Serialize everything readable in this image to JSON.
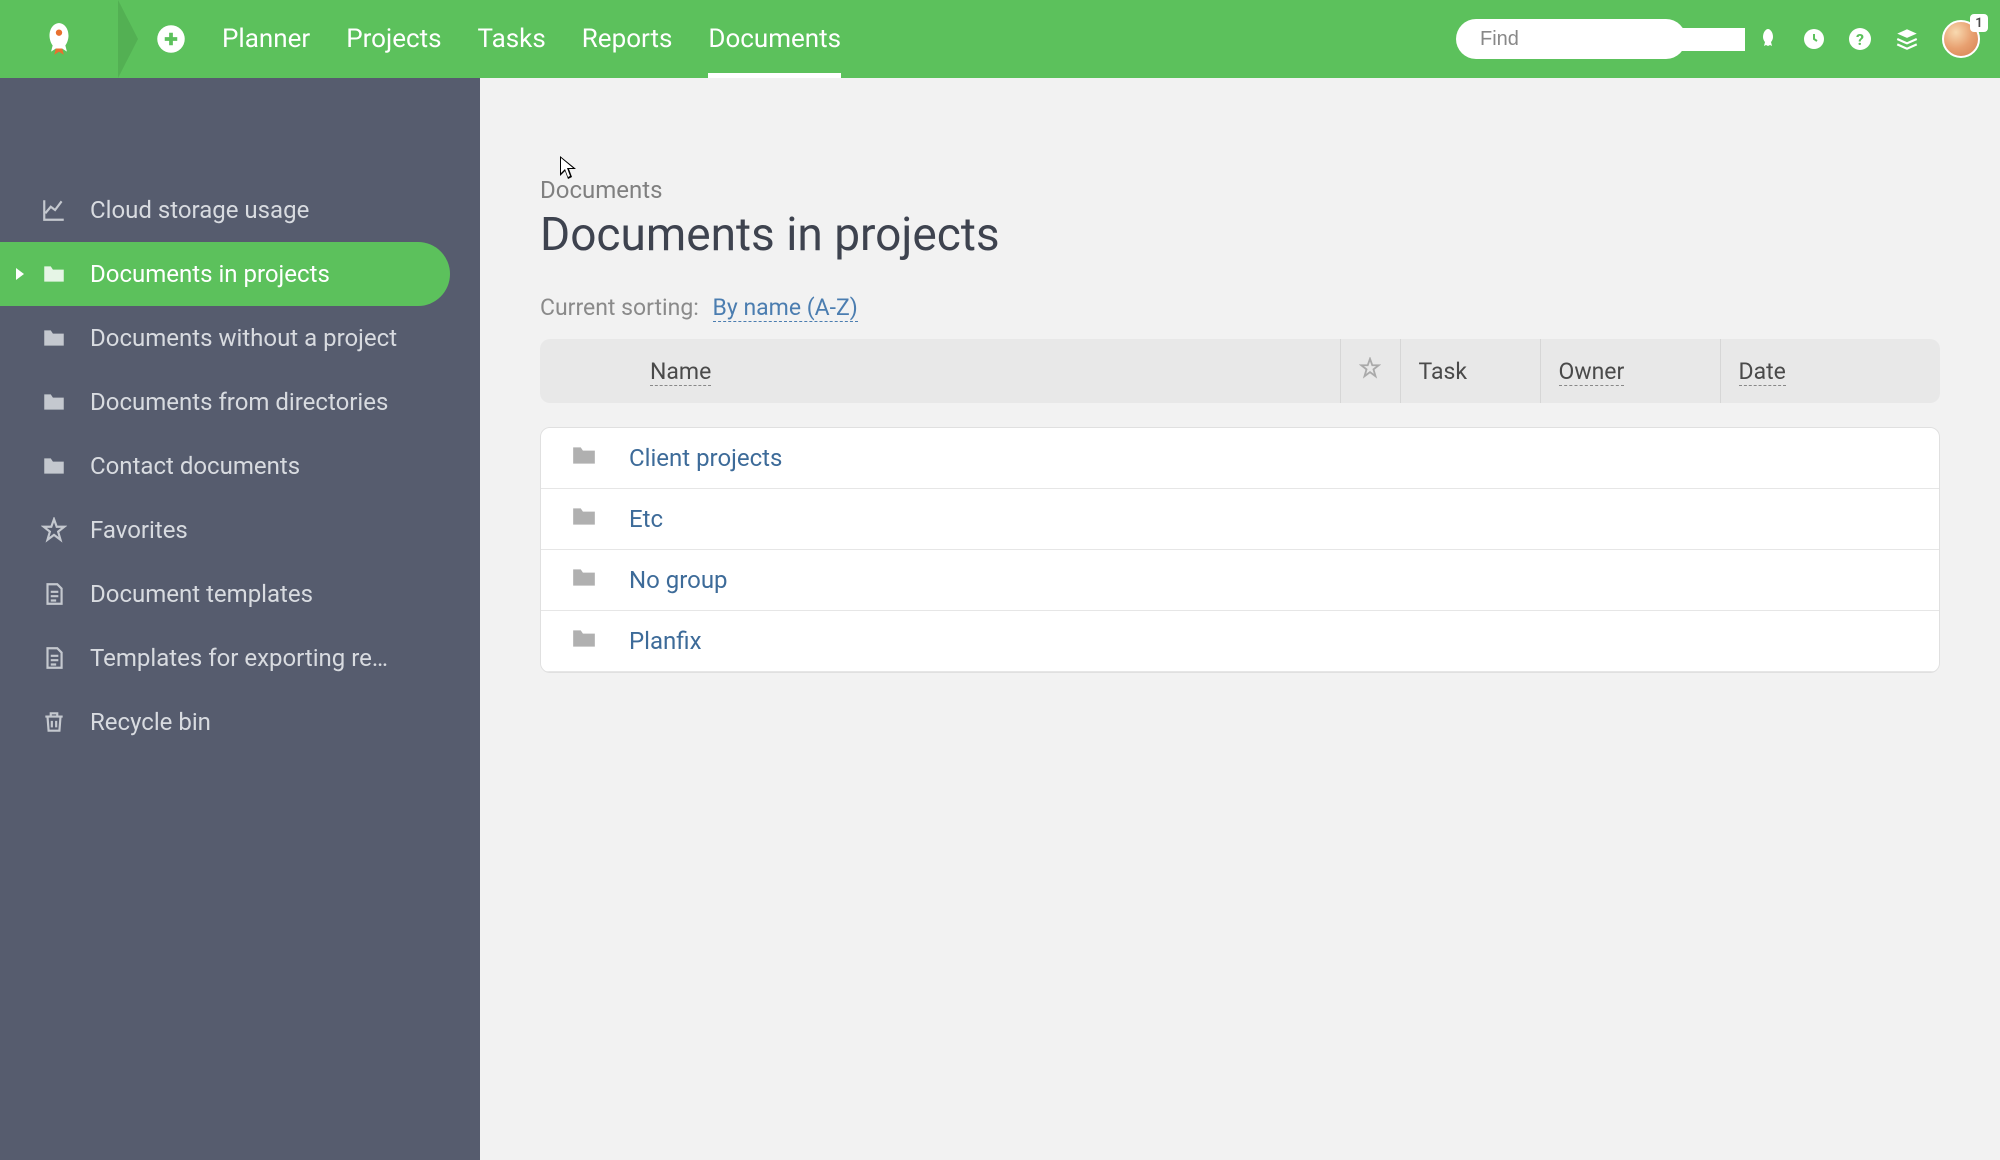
{
  "topbar": {
    "nav": [
      "Planner",
      "Projects",
      "Tasks",
      "Reports",
      "Documents"
    ],
    "active_nav_index": 4,
    "search_placeholder": "Find",
    "avatar_badge": "1"
  },
  "sidebar": {
    "items": [
      {
        "icon": "chart",
        "label": "Cloud storage usage"
      },
      {
        "icon": "folder",
        "label": "Documents in projects"
      },
      {
        "icon": "folder",
        "label": "Documents without a project"
      },
      {
        "icon": "folder",
        "label": "Documents from directories"
      },
      {
        "icon": "folder",
        "label": "Contact documents"
      },
      {
        "icon": "star",
        "label": "Favorites"
      },
      {
        "icon": "doc",
        "label": "Document templates"
      },
      {
        "icon": "doc",
        "label": "Templates for exporting re…"
      },
      {
        "icon": "trash",
        "label": "Recycle bin"
      }
    ],
    "active_index": 1
  },
  "main": {
    "breadcrumb": "Documents",
    "title": "Documents in projects",
    "sort_label": "Current sorting:",
    "sort_value": "By name (A-Z)",
    "columns": {
      "name": "Name",
      "task": "Task",
      "owner": "Owner",
      "date": "Date"
    },
    "rows": [
      {
        "name": "Client projects"
      },
      {
        "name": "Etc"
      },
      {
        "name": "No group"
      },
      {
        "name": "Planfix"
      }
    ]
  }
}
